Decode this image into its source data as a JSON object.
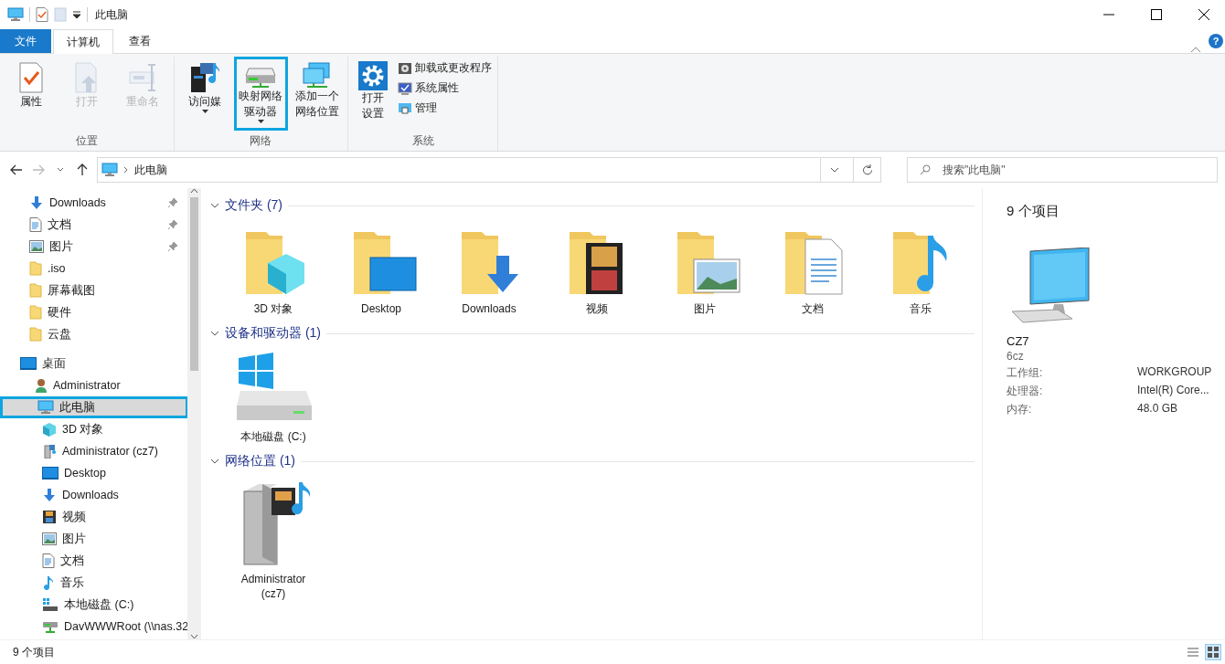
{
  "window": {
    "title": "此电脑"
  },
  "ribbon": {
    "tabs": [
      {
        "label": "文件",
        "kind": "file",
        "selected": false
      },
      {
        "label": "计算机",
        "kind": "tab",
        "selected": true
      },
      {
        "label": "查看",
        "kind": "tab",
        "selected": false
      }
    ],
    "help": "?",
    "groups": [
      {
        "label": "位置",
        "buttons": [
          {
            "label": "属性",
            "kind": "properties",
            "disabled": false,
            "dropdown": false,
            "highlighted": false
          },
          {
            "label": "打开",
            "kind": "open",
            "disabled": true,
            "dropdown": false,
            "highlighted": false
          },
          {
            "label": "重命名",
            "kind": "rename",
            "disabled": true,
            "dropdown": false,
            "highlighted": false
          }
        ]
      },
      {
        "label": "网络",
        "buttons": [
          {
            "label": "访问媒",
            "kind": "media",
            "disabled": false,
            "dropdown": true,
            "highlighted": false
          },
          {
            "label": "映射网络驱动器",
            "kind": "mapdrive",
            "disabled": false,
            "dropdown": true,
            "highlighted": true
          },
          {
            "label": "添加一个网络位置",
            "kind": "netloc",
            "disabled": false,
            "dropdown": false,
            "highlighted": false
          }
        ]
      },
      {
        "label": "系统",
        "buttons": [
          {
            "label": "打开设置",
            "kind": "settings",
            "disabled": false,
            "dropdown": false,
            "highlighted": false
          },
          {
            "label": "卸载或更改程序",
            "kind": "uninstall"
          },
          {
            "label": "系统属性",
            "kind": "sysprops"
          },
          {
            "label": "管理",
            "kind": "manage"
          }
        ]
      }
    ]
  },
  "address": {
    "path": "此电脑"
  },
  "search": {
    "placeholder": "搜索\"此电脑\""
  },
  "quick_access": [
    {
      "label": "Downloads",
      "kind": "download",
      "pinned": true,
      "selected": false
    },
    {
      "label": "文档",
      "kind": "document",
      "pinned": true,
      "selected": false
    },
    {
      "label": "图片",
      "kind": "pictures",
      "pinned": true,
      "selected": false
    },
    {
      "label": ".iso",
      "kind": "folder",
      "pinned": false,
      "selected": false
    },
    {
      "label": "屏幕截图",
      "kind": "folder",
      "pinned": false,
      "selected": false
    },
    {
      "label": "硬件",
      "kind": "folder",
      "pinned": false,
      "selected": false
    },
    {
      "label": "云盘",
      "kind": "folder",
      "pinned": false,
      "selected": false
    }
  ],
  "tree": [
    {
      "label": "桌面",
      "kind": "desktop",
      "selected": false,
      "highlighted": false,
      "children": [
        {
          "label": "Administrator",
          "kind": "user",
          "selected": false,
          "highlighted": false
        },
        {
          "label": "此电脑",
          "kind": "pc",
          "selected": true,
          "highlighted": true,
          "children": [
            {
              "label": "3D 对象",
              "kind": "cube",
              "selected": false,
              "highlighted": false
            },
            {
              "label": "Administrator (cz7)",
              "kind": "netmedia",
              "selected": false,
              "highlighted": false
            },
            {
              "label": "Desktop",
              "kind": "desktop",
              "selected": false,
              "highlighted": false
            },
            {
              "label": "Downloads",
              "kind": "download",
              "selected": false,
              "highlighted": false
            },
            {
              "label": "视频",
              "kind": "video",
              "selected": false,
              "highlighted": false
            },
            {
              "label": "图片",
              "kind": "pictures",
              "selected": false,
              "highlighted": false
            },
            {
              "label": "文档",
              "kind": "document",
              "selected": false,
              "highlighted": false
            },
            {
              "label": "音乐",
              "kind": "music",
              "selected": false,
              "highlighted": false
            },
            {
              "label": "本地磁盘 (C:)",
              "kind": "disk",
              "selected": false,
              "highlighted": false
            },
            {
              "label": "DavWWWRoot (\\\\nas.32",
              "kind": "netdisk",
              "selected": false,
              "highlighted": false
            }
          ]
        }
      ]
    }
  ],
  "sections": [
    {
      "title": "文件夹 (7)",
      "expanded": true,
      "items": [
        {
          "label": "3D 对象",
          "kind": "cube"
        },
        {
          "label": "Desktop",
          "kind": "desktop"
        },
        {
          "label": "Downloads",
          "kind": "download"
        },
        {
          "label": "视频",
          "kind": "video"
        },
        {
          "label": "图片",
          "kind": "pictures"
        },
        {
          "label": "文档",
          "kind": "document"
        },
        {
          "label": "音乐",
          "kind": "music"
        }
      ]
    },
    {
      "title": "设备和驱动器 (1)",
      "expanded": true,
      "items": [
        {
          "label": "本地磁盘 (C:)",
          "kind": "disk"
        }
      ]
    },
    {
      "title": "网络位置 (1)",
      "expanded": true,
      "items": [
        {
          "label": "Administrator\n(cz7)",
          "kind": "netmedia"
        }
      ]
    }
  ],
  "details": {
    "count": "9 个项目",
    "name": "CZ7",
    "subtitle": "6cz",
    "properties": [
      {
        "label": "工作组:",
        "value": "WORKGROUP"
      },
      {
        "label": "处理器:",
        "value": "Intel(R) Core..."
      },
      {
        "label": "内存:",
        "value": "48.0 GB"
      }
    ]
  },
  "status_bar": {
    "count": "9 个项目"
  }
}
